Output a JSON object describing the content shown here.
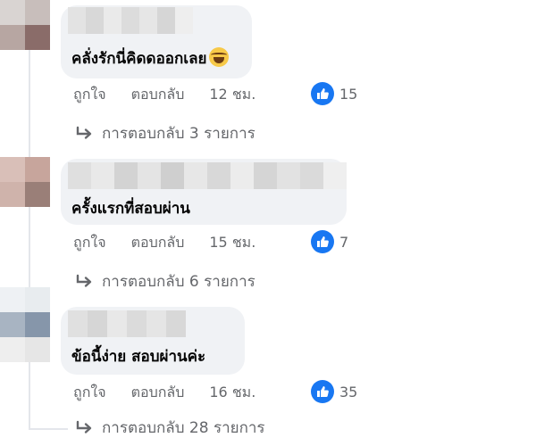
{
  "labels": {
    "like": "ถูกใจ",
    "reply": "ตอบกลับ"
  },
  "colors": {
    "bubble": "#f0f2f5",
    "meta_text": "#65676b",
    "like_blue": "#1877f2"
  },
  "comments": [
    {
      "text": "คลั่งรักนี่คิดดออกเลย",
      "emoji": "laughing-with-tears-emoji",
      "time": "12 ชม.",
      "like_count": "15",
      "replies": "การตอบกลับ 3 รายการ"
    },
    {
      "text": "ครั้งแรกที่สอบผ่าน",
      "time": "15 ชม.",
      "like_count": "7",
      "replies": "การตอบกลับ 6 รายการ"
    },
    {
      "text": "ข้อนี้ง่าย สอบผ่านค่ะ",
      "time": "16 ชม.",
      "like_count": "35",
      "replies": "การตอบกลับ 28 รายการ"
    }
  ]
}
